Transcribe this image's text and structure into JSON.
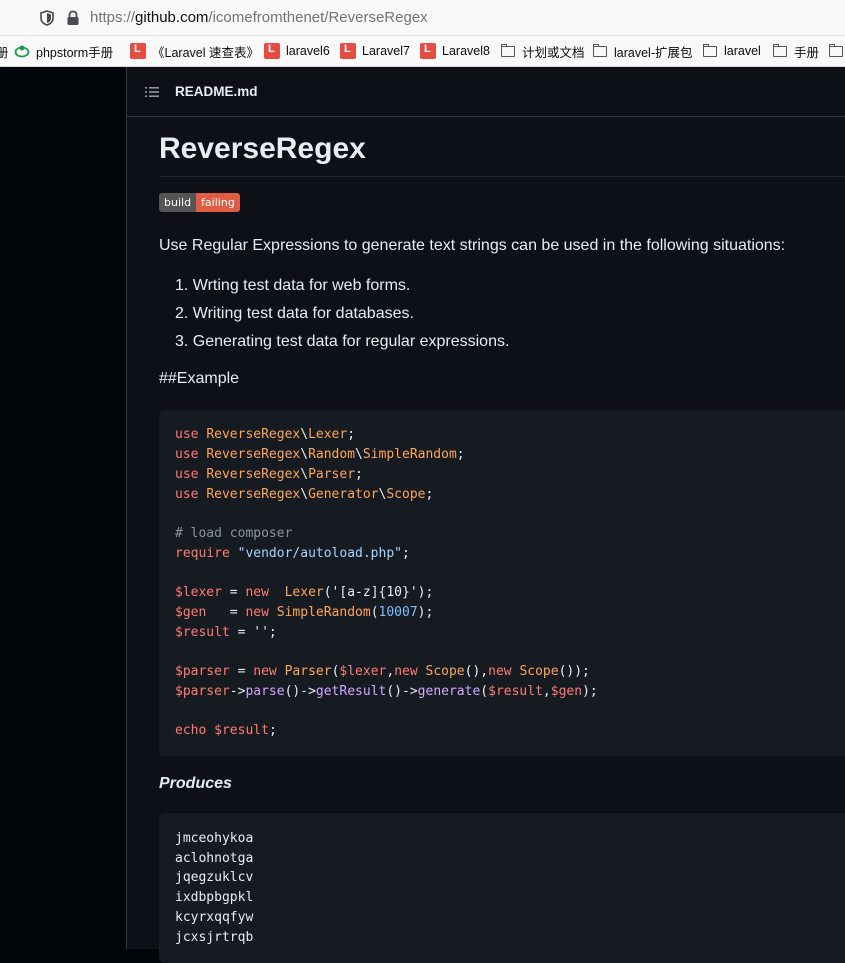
{
  "browser": {
    "url_prefix": "https://",
    "url_host": "github.com",
    "url_path": "/icomefromthenet/ReverseRegex",
    "bookmarks": [
      {
        "label": "phpstorm手册",
        "icon": "ticket-icon"
      },
      {
        "label": "《Laravel 速查表》",
        "icon": "laravel-icon"
      },
      {
        "label": "laravel6",
        "icon": "laravel-icon"
      },
      {
        "label": "Laravel7",
        "icon": "laravel-icon"
      },
      {
        "label": "Laravel8",
        "icon": "laravel-icon"
      },
      {
        "label": "计划或文档",
        "icon": "folder-icon"
      },
      {
        "label": "laravel-扩展包",
        "icon": "folder-icon"
      },
      {
        "label": "laravel",
        "icon": "folder-icon"
      },
      {
        "label": "手册",
        "icon": "folder-icon"
      }
    ]
  },
  "readme": {
    "filename": "README.md",
    "title": "ReverseRegex",
    "badge": {
      "left": "build",
      "right": "failing"
    },
    "intro": "Use Regular Expressions to generate text strings can be used in the following situations:",
    "list": [
      "1. Wrting test data for web forms.",
      "2. Writing test data for databases.",
      "3. Generating test data for regular expressions."
    ],
    "example_heading": "##Example",
    "produces_label": "Produces",
    "produces_output": [
      "jmceohykoa",
      "aclohnotga",
      "jqegzuklcv",
      "ixdbpbgpkl",
      "kcyrxqqfyw",
      "jcxsjrtrqb"
    ]
  },
  "code": {
    "l1": [
      [
        "use ",
        "kw"
      ],
      [
        "ReverseRegex",
        "cls"
      ],
      [
        "\\",
        ""
      ],
      [
        "Lexer",
        "cls"
      ],
      [
        ";",
        ""
      ]
    ],
    "l2": [
      [
        "use ",
        "kw"
      ],
      [
        "ReverseRegex",
        "cls"
      ],
      [
        "\\",
        ""
      ],
      [
        "Random",
        "cls"
      ],
      [
        "\\",
        ""
      ],
      [
        "SimpleRandom",
        "cls"
      ],
      [
        ";",
        ""
      ]
    ],
    "l3": [
      [
        "use ",
        "kw"
      ],
      [
        "ReverseRegex",
        "cls"
      ],
      [
        "\\",
        ""
      ],
      [
        "Parser",
        "cls"
      ],
      [
        ";",
        ""
      ]
    ],
    "l4": [
      [
        "use ",
        "kw"
      ],
      [
        "ReverseRegex",
        "cls"
      ],
      [
        "\\",
        ""
      ],
      [
        "Generator",
        "cls"
      ],
      [
        "\\",
        ""
      ],
      [
        "Scope",
        "cls"
      ],
      [
        ";",
        ""
      ]
    ],
    "l5": [
      [
        "# load composer",
        "cm"
      ]
    ],
    "l6": [
      [
        "require ",
        "kw"
      ],
      [
        "\"vendor/autoload.php\"",
        "str"
      ],
      [
        ";",
        ""
      ]
    ],
    "l7": [
      [
        "$lexer ",
        "kw"
      ],
      [
        "= ",
        ""
      ],
      [
        "new  ",
        "kw"
      ],
      [
        "Lexer",
        "cls"
      ],
      [
        "('[a-z]{10}');",
        ""
      ]
    ],
    "l8": [
      [
        "$gen   ",
        "kw"
      ],
      [
        "= ",
        ""
      ],
      [
        "new ",
        "kw"
      ],
      [
        "SimpleRandom",
        "cls"
      ],
      [
        "(",
        ""
      ],
      [
        "10007",
        "num"
      ],
      [
        ");",
        ""
      ]
    ],
    "l9": [
      [
        "$result ",
        "kw"
      ],
      [
        "= '';",
        ""
      ]
    ],
    "l10": [
      [
        "$parser ",
        "kw"
      ],
      [
        "= ",
        ""
      ],
      [
        "new ",
        "kw"
      ],
      [
        "Parser",
        "cls"
      ],
      [
        "(",
        ""
      ],
      [
        "$lexer",
        "kw"
      ],
      [
        ",",
        ""
      ],
      [
        "new ",
        "kw"
      ],
      [
        "Scope",
        "cls"
      ],
      [
        "(),",
        ""
      ],
      [
        "new ",
        "kw"
      ],
      [
        "Scope",
        "cls"
      ],
      [
        "());",
        ""
      ]
    ],
    "l11": [
      [
        "$parser",
        "kw"
      ],
      [
        "->",
        ""
      ],
      [
        "parse",
        "fn"
      ],
      [
        "()->",
        ""
      ],
      [
        "getResult",
        "fn"
      ],
      [
        "()->",
        ""
      ],
      [
        "generate",
        "fn"
      ],
      [
        "(",
        ""
      ],
      [
        "$result",
        "kw"
      ],
      [
        ",",
        ""
      ],
      [
        "$gen",
        "kw"
      ],
      [
        ");",
        ""
      ]
    ],
    "l12": [
      [
        "echo ",
        "kw"
      ],
      [
        "$result",
        "kw"
      ],
      [
        ";",
        ""
      ]
    ]
  }
}
